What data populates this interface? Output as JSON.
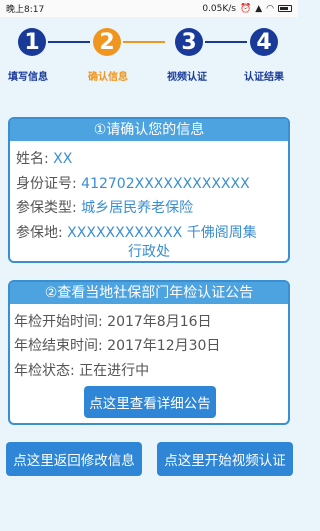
{
  "status_bar": {
    "time": "晚上8:17",
    "speed": "0.05K/s"
  },
  "steps": [
    {
      "number": "1",
      "label": "填写信息",
      "color": "#1a3a9a"
    },
    {
      "number": "2",
      "label": "确认信息",
      "color": "#f09620"
    },
    {
      "number": "3",
      "label": "视频认证",
      "color": "#1a3a9a"
    },
    {
      "number": "4",
      "label": "认证结果",
      "color": "#1a3a9a"
    }
  ],
  "confirm_panel": {
    "title": "①请确认您的信息",
    "name_label": "姓名:",
    "name_value": "XX",
    "id_label": "身份证号:",
    "id_value": "412702XXXXXXXXXXXX",
    "type_label": "参保类型:",
    "type_value": "城乡居民养老保险",
    "place_label": "参保地:",
    "place_value_line1": "XXXXXXXXXXXX 千佛阁周集",
    "place_value_line2": "行政处"
  },
  "notice_panel": {
    "title": "②查看当地社保部门年检认证公告",
    "start_label": "年检开始时间:",
    "start_value": "2017年8月16日",
    "end_label": "年检结束时间:",
    "end_value": "2017年12月30日",
    "status_label": "年检状态:",
    "status_value": "正在进行中",
    "detail_button": "点这里查看详细公告"
  },
  "bottom_buttons": {
    "back": "点这里返回修改信息",
    "start_video": "点这里开始视频认证"
  }
}
